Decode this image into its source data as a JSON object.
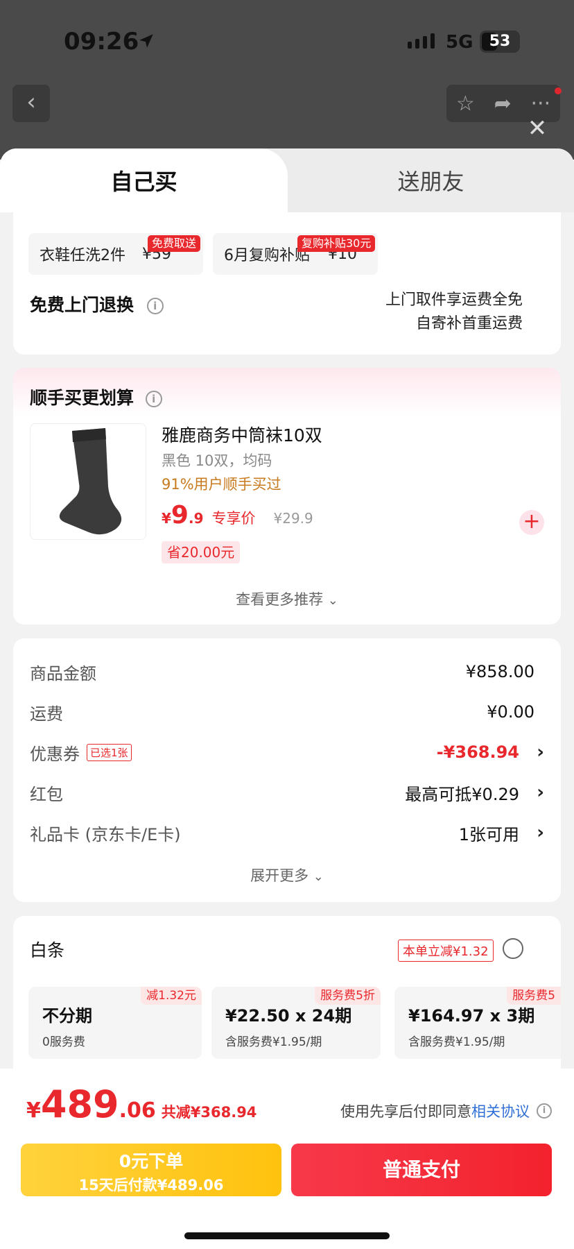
{
  "status": {
    "time": "09:26",
    "network": "5G",
    "battery": "53"
  },
  "sheet": {
    "close_label": "✕",
    "tabs": [
      {
        "label": "自己买"
      },
      {
        "label": "送朋友"
      }
    ]
  },
  "service": {
    "chips": [
      {
        "name": "衣鞋任洗2件",
        "price": "¥59",
        "badge": "免费取送"
      },
      {
        "name": "6月复购补贴",
        "price": "¥10",
        "badge": "复购补贴30元"
      }
    ],
    "return_title": "免费上门退换",
    "return_desc_1": "上门取件享运费全免",
    "return_desc_2": "自寄补首重运费"
  },
  "addon": {
    "title": "顺手买更划算",
    "product": {
      "name": "雅鹿商务中筒袜10双",
      "spec": "黑色 10双，均码",
      "social": "91%用户顺手买过",
      "currency": "¥",
      "price_int": "9",
      "price_dec": ".9",
      "price_tag": "专享价",
      "orig_price": "¥29.9",
      "save": "省20.00元"
    },
    "more": "查看更多推荐"
  },
  "summary": {
    "rows": [
      {
        "label": "商品金额",
        "value": "¥858.00"
      },
      {
        "label": "运费",
        "value": "¥0.00"
      },
      {
        "label": "优惠券",
        "tag": "已选1张",
        "value": "-¥368.94"
      },
      {
        "label": "红包",
        "value": "最高可抵¥0.29"
      },
      {
        "label": "礼品卡 (京东卡/E卡)",
        "value": "1张可用"
      }
    ],
    "expand": "展开更多"
  },
  "baitiao": {
    "title": "白条",
    "promo": "本单立减¥1.32",
    "options": [
      {
        "badge": "减1.32元",
        "main": "不分期",
        "sub": "0服务费"
      },
      {
        "badge": "服务费5折",
        "main": "¥22.50 x 24期",
        "sub": "含服务费¥1.95/期"
      },
      {
        "badge": "服务费5",
        "main": "¥164.97 x 3期",
        "sub": "含服务费¥1.95/期"
      }
    ]
  },
  "bottom": {
    "currency": "¥",
    "total_int": "489",
    "total_dec": ".06",
    "discount": "共减¥368.94",
    "agree_text": "使用先享后付即同意",
    "agree_link": "相关协议",
    "zero_title": "0元下单",
    "zero_sub": "15天后付款¥489.06",
    "pay_label": "普通支付"
  },
  "colors": {
    "accent": "#e8282d",
    "link": "#2f6fd6",
    "social": "#c87a1e",
    "yellow": "#ffc20e"
  }
}
